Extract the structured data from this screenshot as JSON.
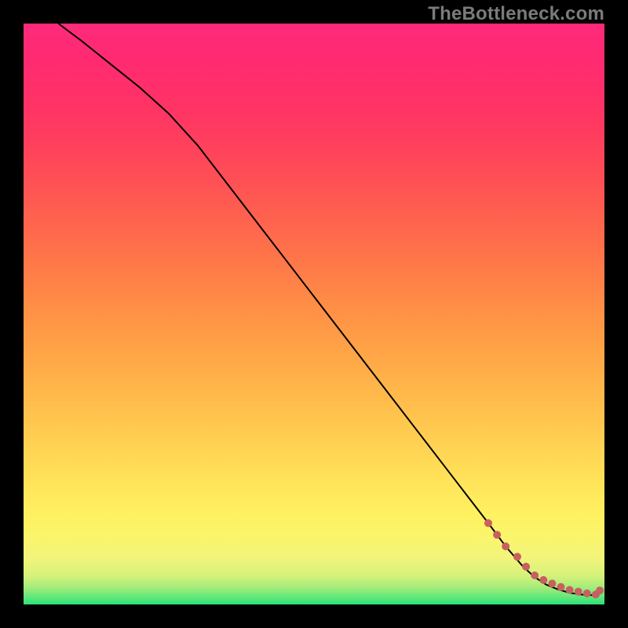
{
  "watermark": "TheBottleneck.com",
  "chart_data": {
    "type": "line",
    "title": "",
    "xlabel": "",
    "ylabel": "",
    "xlim": [
      0,
      100
    ],
    "ylim": [
      0,
      100
    ],
    "grid": false,
    "series": [
      {
        "name": "black-curve",
        "stroke": "#000000",
        "stroke_width": 2,
        "x": [
          6,
          10,
          15,
          20,
          25,
          30,
          35,
          40,
          45,
          50,
          55,
          60,
          65,
          70,
          75,
          80,
          83,
          86,
          88,
          90,
          92,
          94,
          96,
          98,
          99
        ],
        "y": [
          100,
          97,
          93,
          89,
          84.5,
          79,
          72.5,
          66,
          59.5,
          53,
          46.5,
          40,
          33.5,
          27,
          20.5,
          14,
          10,
          6.5,
          4.7,
          3.4,
          2.6,
          2.0,
          1.7,
          1.6,
          2.2
        ]
      },
      {
        "name": "dots",
        "stroke": "none",
        "marker_color": "#c86060",
        "marker_radius": 5,
        "x": [
          80,
          81.5,
          83,
          85,
          86.5,
          88,
          89.5,
          91,
          92.5,
          94,
          95.5,
          97,
          98.5,
          99.2
        ],
        "y": [
          14,
          12,
          10,
          8.2,
          6.5,
          5,
          4.2,
          3.6,
          3.0,
          2.5,
          2.2,
          1.9,
          1.7,
          2.4
        ]
      }
    ],
    "background_gradient": {
      "direction": "vertical",
      "stops": [
        {
          "pos": 0.0,
          "color": "#2ae27a"
        },
        {
          "pos": 0.05,
          "color": "#d6f27a"
        },
        {
          "pos": 0.16,
          "color": "#fff060"
        },
        {
          "pos": 0.4,
          "color": "#ffae48"
        },
        {
          "pos": 0.7,
          "color": "#ff5852"
        },
        {
          "pos": 1.0,
          "color": "#ff2a7a"
        }
      ]
    }
  }
}
